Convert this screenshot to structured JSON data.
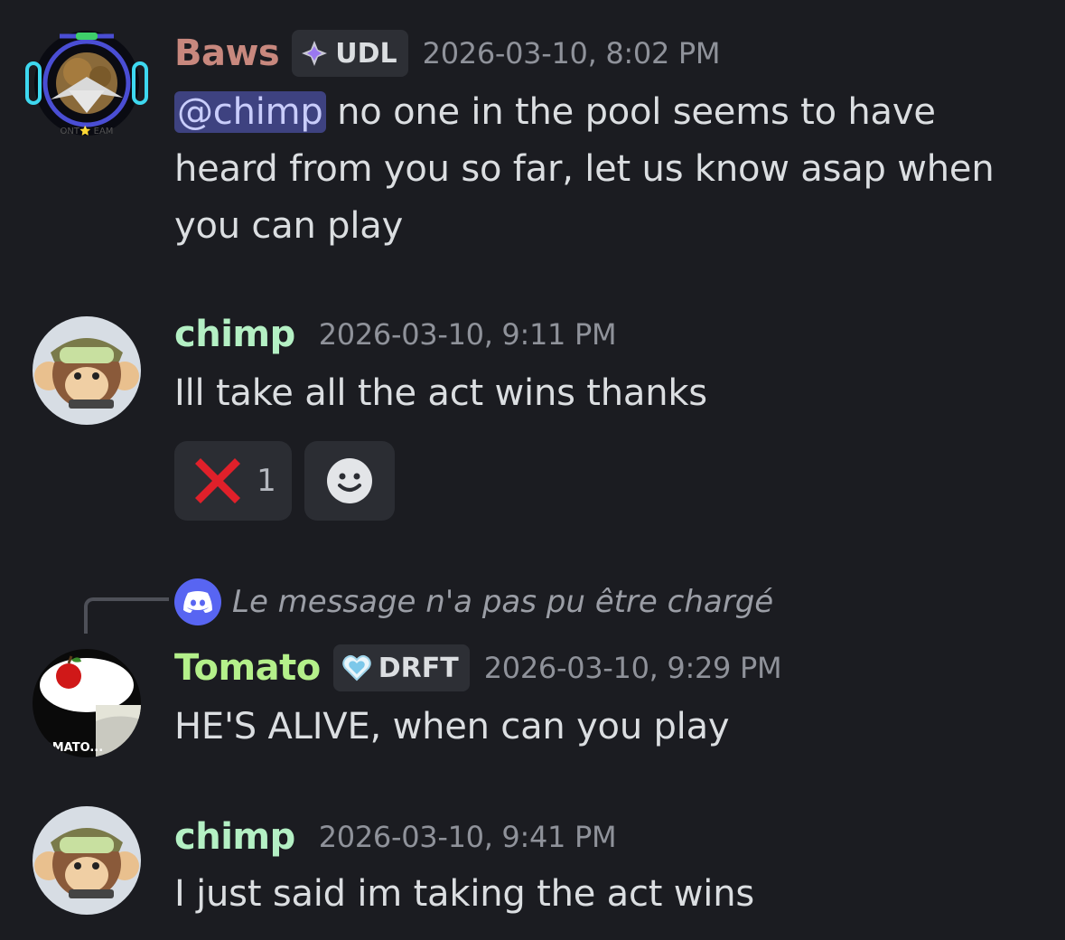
{
  "messages": [
    {
      "username": "Baws",
      "username_color": "#c8887e",
      "role_badge": "UDL",
      "role_icon": "diamond-star-icon",
      "timestamp": "2026-03-10, 8:02 PM",
      "mention": "@chimp",
      "text": " no one in the pool seems to have heard from you so far, let us know asap when you can play",
      "avatar_text": "ONT⭐ EAM"
    },
    {
      "username": "chimp",
      "username_color": "#b4f0c4",
      "timestamp": "2026-03-10, 9:11 PM",
      "text": "Ill take all the act wins thanks",
      "reactions": [
        {
          "emoji": "❌",
          "count": "1",
          "icon": "cross-mark-icon"
        },
        {
          "icon": "add-reaction-icon"
        }
      ]
    },
    {
      "reply": {
        "text": "Le message n'a pas pu être chargé",
        "icon": "discord-icon"
      },
      "username": "Tomato",
      "username_color": "#b4f08a",
      "role_badge": "DRFT",
      "role_icon": "heart-icon",
      "timestamp": "2026-03-10, 9:29 PM",
      "text": "HE'S ALIVE, when can you play",
      "avatar_text": "TOMATO..."
    },
    {
      "username": "chimp",
      "username_color": "#b4f0c4",
      "timestamp": "2026-03-10, 9:41 PM",
      "text": "I just said im taking the act wins"
    }
  ]
}
